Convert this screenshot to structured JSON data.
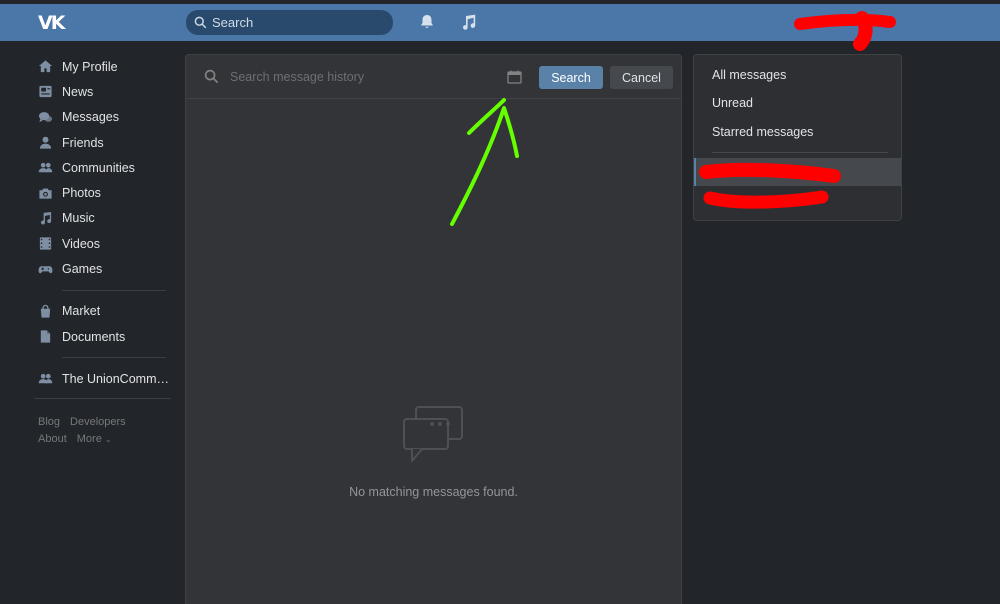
{
  "header": {
    "logo": "VK",
    "search_placeholder": "Search",
    "icons": [
      "bell-icon",
      "music-note-icon"
    ]
  },
  "sidebar": {
    "items": [
      {
        "label": "My Profile",
        "icon": "home-icon"
      },
      {
        "label": "News",
        "icon": "newspaper-icon"
      },
      {
        "label": "Messages",
        "icon": "chat-bubbles-icon"
      },
      {
        "label": "Friends",
        "icon": "user-icon"
      },
      {
        "label": "Communities",
        "icon": "group-icon"
      },
      {
        "label": "Photos",
        "icon": "camera-icon"
      },
      {
        "label": "Music",
        "icon": "music-note-icon"
      },
      {
        "label": "Videos",
        "icon": "film-icon"
      },
      {
        "label": "Games",
        "icon": "gamepad-icon"
      }
    ],
    "secondary": [
      {
        "label": "Market",
        "icon": "shopping-bag-icon"
      },
      {
        "label": "Documents",
        "icon": "document-icon"
      }
    ],
    "communities": [
      {
        "label": "The UnionCommun…",
        "icon": "group-icon"
      }
    ],
    "footer": {
      "blog": "Blog",
      "developers": "Developers",
      "about": "About",
      "more": "More"
    }
  },
  "main": {
    "search_placeholder": "Search message history",
    "search_button": "Search",
    "cancel_button": "Cancel",
    "empty_text": "No matching messages found."
  },
  "filters": {
    "items": [
      "All messages",
      "Unread",
      "Starred messages"
    ]
  },
  "colors": {
    "header": "#4a76a8",
    "background": "#222529",
    "panel": "#323437",
    "accent": "#5a81a8",
    "redaction": "#ff0000",
    "annotation_arrow": "#66ff00"
  }
}
